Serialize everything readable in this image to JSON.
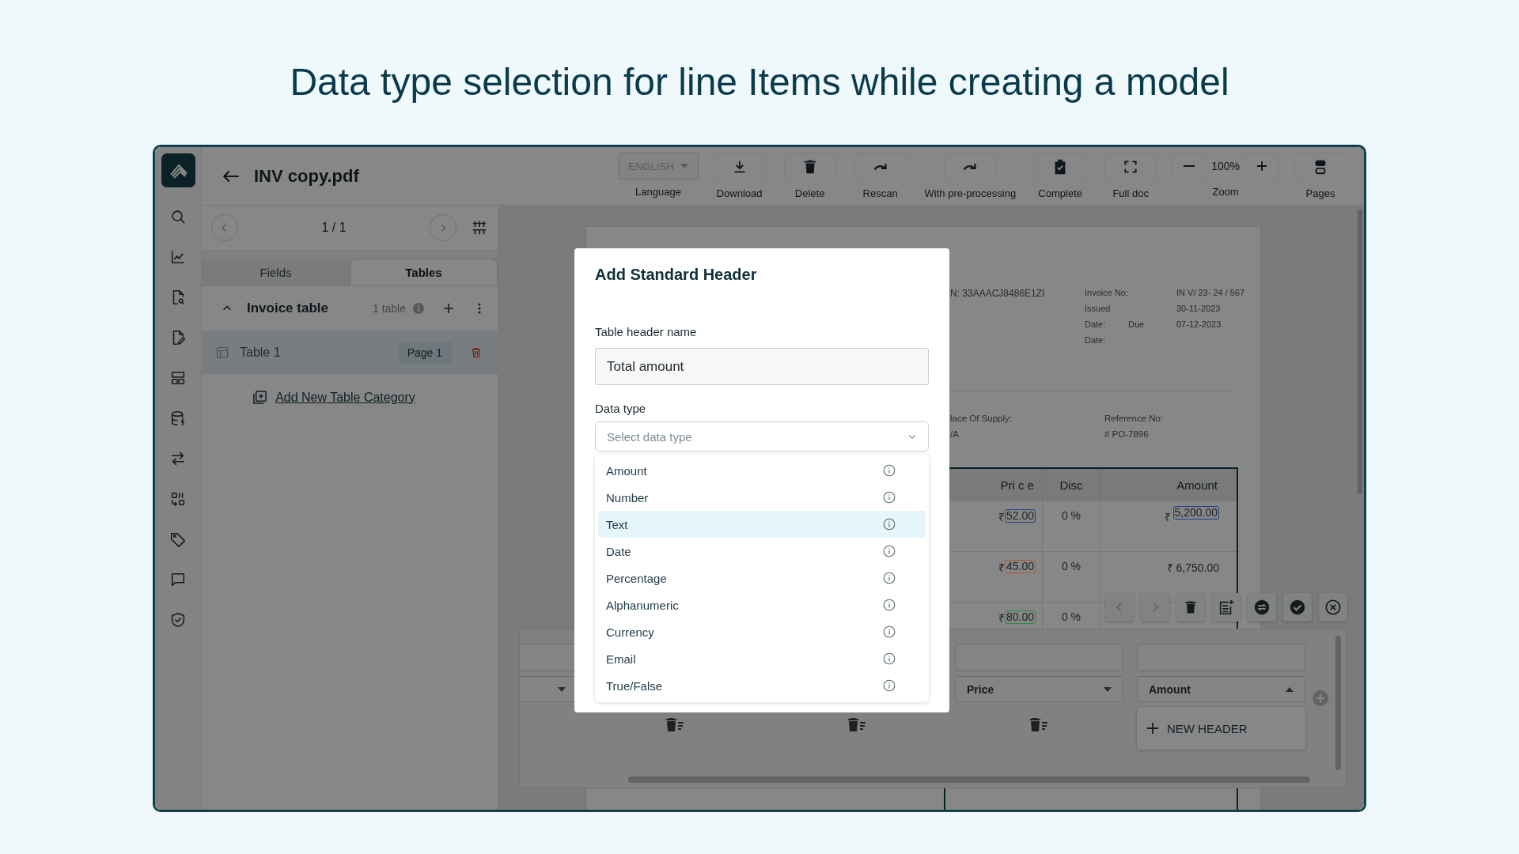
{
  "heading": "Data type selection for line Items while creating a model",
  "file_name": "INV copy.pdf",
  "toolbar": [
    {
      "kind": "language",
      "value": "ENGLISH",
      "label": "Language",
      "disabled": true
    },
    {
      "kind": "download",
      "label": "Download"
    },
    {
      "kind": "delete",
      "label": "Delete"
    },
    {
      "kind": "rescan",
      "label": "Rescan"
    },
    {
      "kind": "preprocess",
      "label": "With pre-processing"
    },
    {
      "kind": "complete",
      "label": "Complete"
    },
    {
      "kind": "fulldoc",
      "label": "Full doc"
    },
    {
      "kind": "zoom",
      "value": "100%",
      "label": "Zoom"
    },
    {
      "kind": "pages",
      "label": "Pages"
    }
  ],
  "pager": "1 / 1",
  "tabs": [
    {
      "label": "Fields",
      "selected": false
    },
    {
      "label": "Tables",
      "selected": true
    }
  ],
  "category": {
    "name": "Invoice table",
    "count": "1 table",
    "expanded": true
  },
  "tables": [
    {
      "name": "Table 1",
      "page": "Page 1",
      "selected": true
    }
  ],
  "add_category": "Add New Table Category",
  "document": {
    "gstin": "N: 33AAACJ8486E1ZI",
    "meta": [
      {
        "label": "Invoice No:",
        "value": "IN V/ 23- 24 / 567"
      },
      {
        "label": "Issued",
        "value": "30-11-2023"
      },
      {
        "label": "Date:",
        "label_2": "Due",
        "value": "07-12-2023"
      },
      {
        "label": "Date:"
      }
    ],
    "supply_label": "lace Of Supply:",
    "supply_value": "/A",
    "reference_label": "Reference No:",
    "reference_value": "# PO-7896",
    "columns": [
      "Pri c e",
      "Disc",
      "Amount"
    ],
    "rows": [
      {
        "currency": "₹",
        "price": "52.00",
        "color": "#24408a",
        "disc": "0 %",
        "amount_currency": "₹",
        "amount": "5,200.00",
        "amount_highlighted": true
      },
      {
        "currency": "₹",
        "price": "45.00",
        "color": "#b3582a",
        "disc": "0 %",
        "amount": "₹ 6,750.00",
        "amount_highlighted": false
      },
      {
        "currency": "₹",
        "price": "80.00",
        "color": "#2e8a44",
        "disc": "0 %"
      }
    ]
  },
  "editor": {
    "columns": [
      {
        "expanded": false
      },
      {},
      {},
      {
        "label": "Price",
        "expanded": false
      },
      {
        "label": "Amount",
        "expanded": true
      }
    ],
    "new_header": "NEW HEADER"
  },
  "modal": {
    "title": "Add Standard Header",
    "name_label": "Table header name",
    "name_value": "Total amount",
    "type_label": "Data type",
    "type_placeholder": "Select data type",
    "options": [
      {
        "label": "Amount",
        "selected": false
      },
      {
        "label": "Number",
        "selected": false
      },
      {
        "label": "Text",
        "selected": true
      },
      {
        "label": "Date",
        "selected": false
      },
      {
        "label": "Percentage",
        "selected": false
      },
      {
        "label": "Alphanumeric",
        "selected": false
      },
      {
        "label": "Currency",
        "selected": false
      },
      {
        "label": "Email",
        "selected": false
      },
      {
        "label": "True/False",
        "selected": false
      }
    ]
  }
}
